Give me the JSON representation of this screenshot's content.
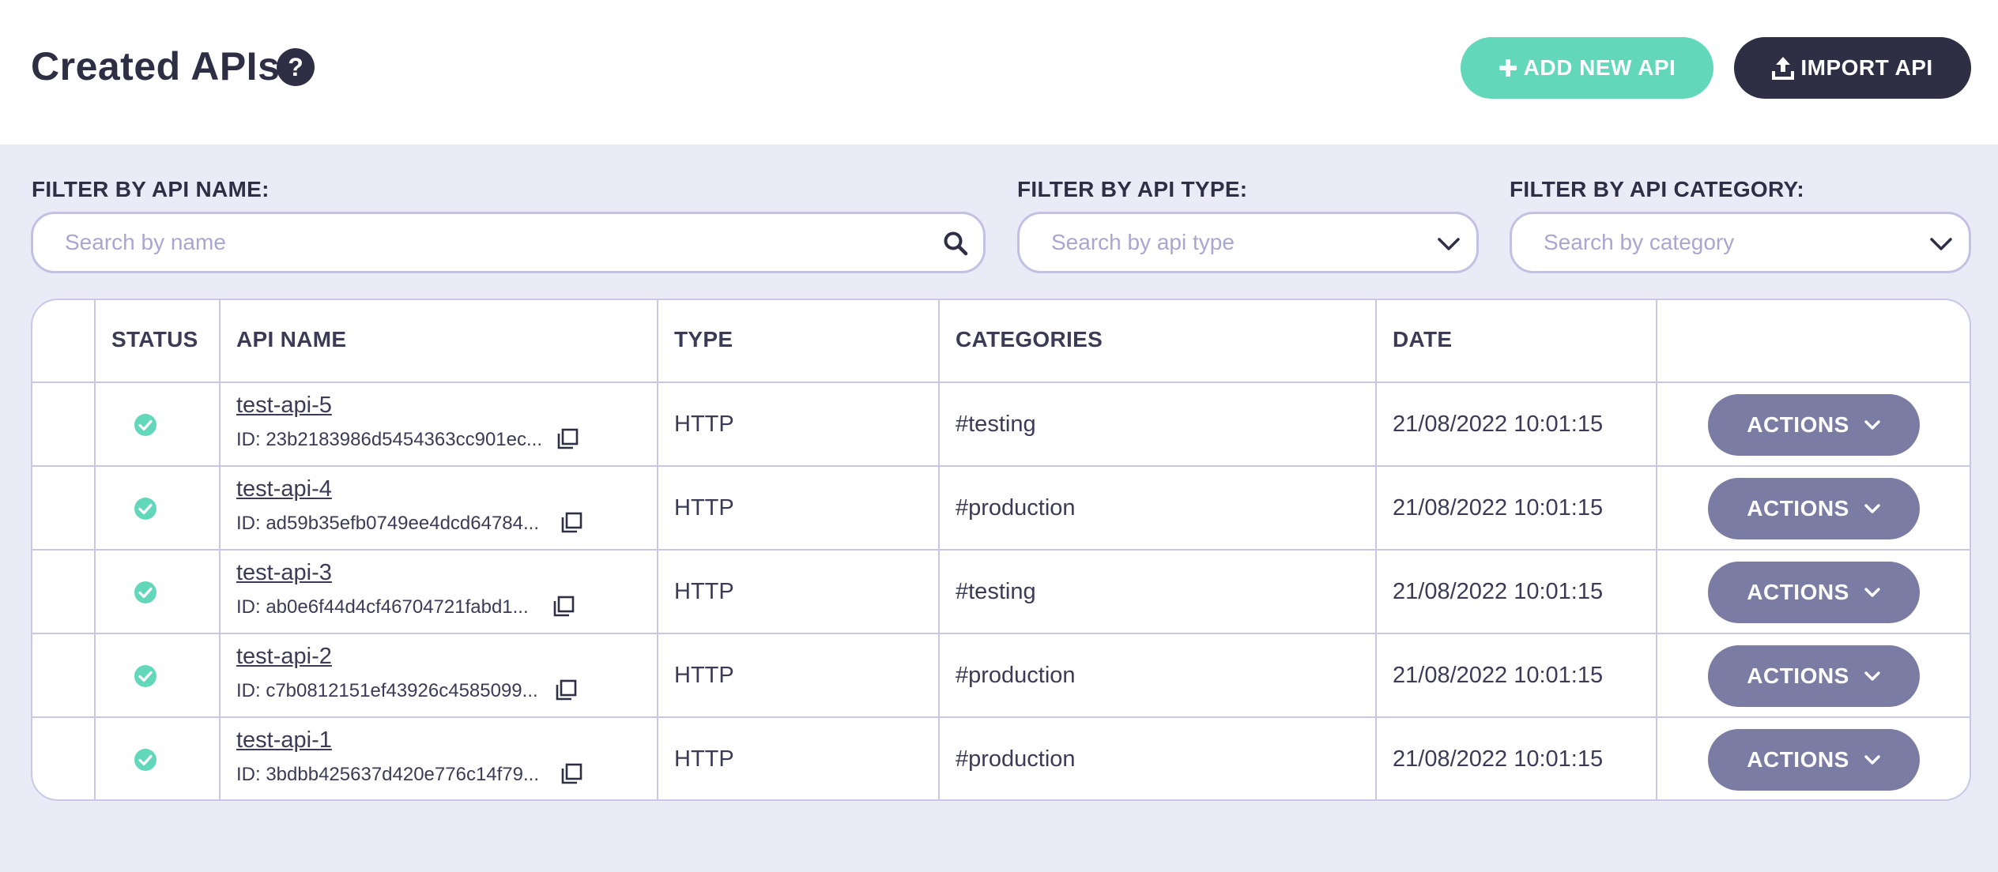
{
  "header": {
    "title": "Created APIs",
    "help_glyph": "?",
    "add_button": "ADD NEW API",
    "import_button": "IMPORT API"
  },
  "filters": {
    "name_label": "FILTER BY API NAME:",
    "name_placeholder": "Search by name",
    "type_label": "FILTER BY API TYPE:",
    "type_placeholder": "Search by api type",
    "category_label": "FILTER BY API CATEGORY:",
    "category_placeholder": "Search by category"
  },
  "table": {
    "columns": [
      "STATUS",
      "API NAME",
      "TYPE",
      "CATEGORIES",
      "DATE"
    ],
    "rows": [
      {
        "name": "test-api-5",
        "id": "ID: 23b2183986d5454363cc901ec...",
        "type": "HTTP",
        "category": "#testing",
        "date": "21/08/2022 10:01:15",
        "action": "ACTIONS",
        "status": "active"
      },
      {
        "name": "test-api-4",
        "id": "ID: ad59b35efb0749ee4dcd64784...",
        "type": "HTTP",
        "category": "#production",
        "date": "21/08/2022 10:01:15",
        "action": "ACTIONS",
        "status": "active"
      },
      {
        "name": "test-api-3",
        "id": "ID: ab0e6f44d4cf46704721fabd1...",
        "type": "HTTP",
        "category": "#testing",
        "date": "21/08/2022 10:01:15",
        "action": "ACTIONS",
        "status": "active"
      },
      {
        "name": "test-api-2",
        "id": "ID: c7b0812151ef43926c4585099...",
        "type": "HTTP",
        "category": "#production",
        "date": "21/08/2022 10:01:15",
        "action": "ACTIONS",
        "status": "active"
      },
      {
        "name": "test-api-1",
        "id": "ID: 3bdbb425637d420e776c14f79...",
        "type": "HTTP",
        "category": "#production",
        "date": "21/08/2022 10:01:15",
        "action": "ACTIONS",
        "status": "active"
      }
    ]
  },
  "icons": {
    "help": "question-circle-icon",
    "add": "plus-icon",
    "import": "upload-icon",
    "search": "search-icon",
    "dropdown": "chevron-down-icon",
    "status": "check-circle-icon",
    "copy": "copy-icon"
  },
  "colors": {
    "accent_green": "#63d7ba",
    "dark": "#2e2e45",
    "actions_bg": "#7b7ca3",
    "page_bg": "#ebebf7",
    "border": "#c9c7e6"
  }
}
